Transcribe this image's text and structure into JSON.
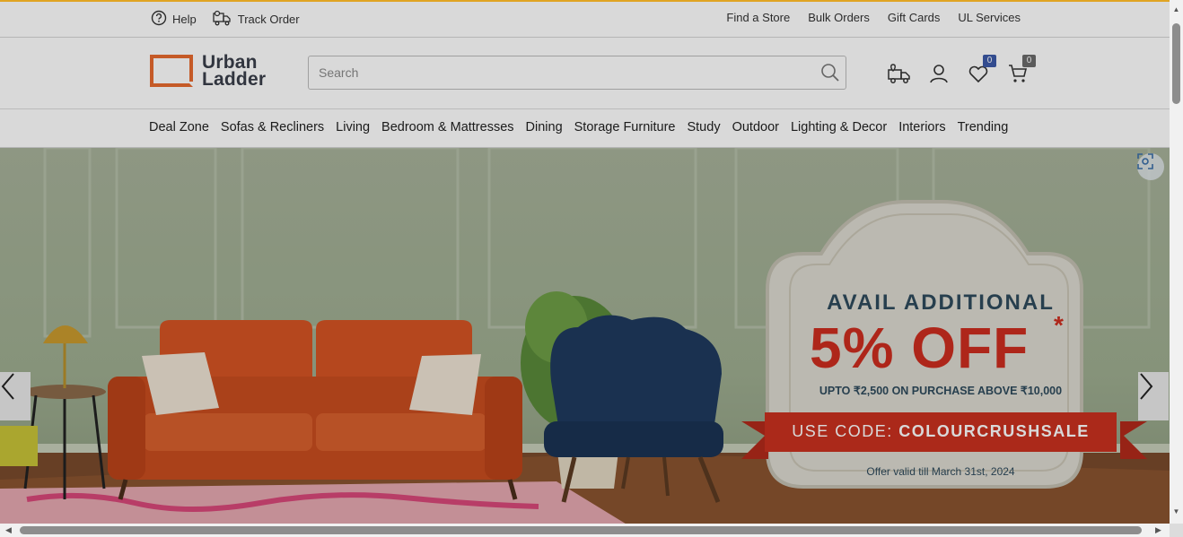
{
  "topbar": {
    "help_label": "Help",
    "track_order_label": "Track Order",
    "links": [
      "Find a Store",
      "Bulk Orders",
      "Gift Cards",
      "UL Services"
    ]
  },
  "brand": {
    "line1": "Urban",
    "line2": "Ladder",
    "accent_color": "#e86a2e"
  },
  "search": {
    "placeholder": "Search",
    "value": ""
  },
  "header_icons": {
    "wishlist_count": "0",
    "cart_count": "0"
  },
  "nav": {
    "items": [
      "Deal Zone",
      "Sofas & Recliners",
      "Living",
      "Bedroom & Mattresses",
      "Dining",
      "Storage Furniture",
      "Study",
      "Outdoor",
      "Lighting & Decor",
      "Interiors",
      "Trending"
    ]
  },
  "hero": {
    "title": "AVAIL ADDITIONAL",
    "offer": "5% OFF",
    "offer_mark": "*",
    "subtitle": "UPTO ₹2,500 ON PURCHASE ABOVE ₹10,000",
    "code_prefix": "USE CODE:",
    "code": "COLOURCRUSHSALE",
    "validity": "Offer valid till March 31st, 2024",
    "offer_color": "#cd2d1f",
    "title_color": "#2e4a5c"
  }
}
